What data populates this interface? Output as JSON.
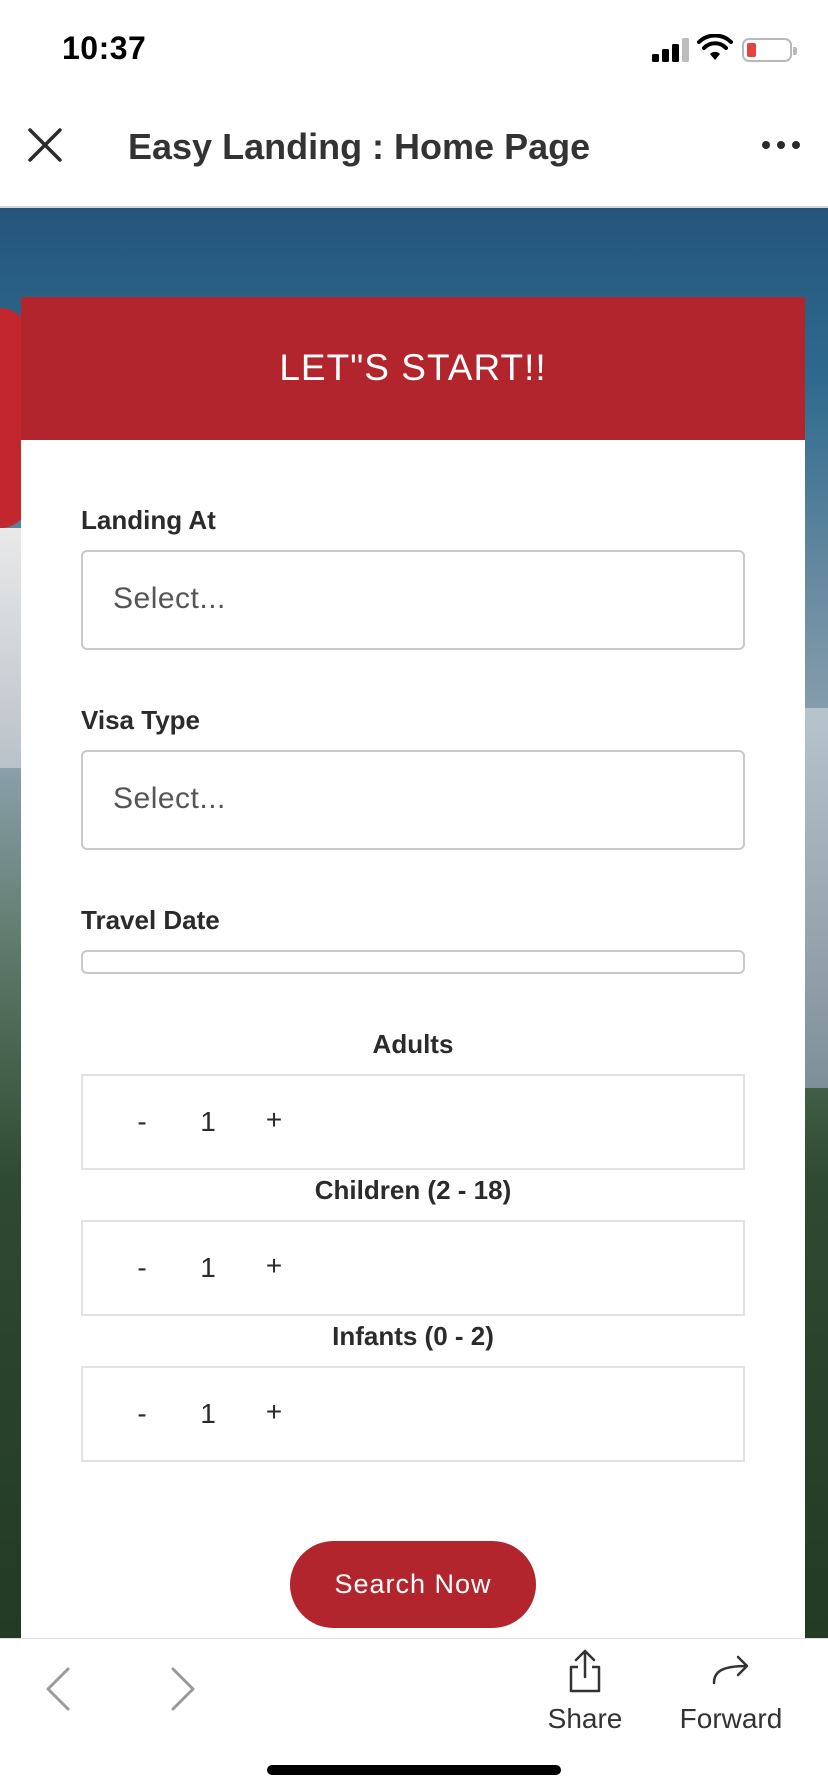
{
  "status_bar": {
    "time": "10:37"
  },
  "header": {
    "title": "Easy Landing : Home Page"
  },
  "card": {
    "title": "LET\"S START!!"
  },
  "form": {
    "landing_at": {
      "label": "Landing At",
      "placeholder": "Select..."
    },
    "visa_type": {
      "label": "Visa Type",
      "placeholder": "Select..."
    },
    "travel_date": {
      "label": "Travel Date"
    },
    "adults": {
      "label": "Adults",
      "minus": "-",
      "value": "1",
      "plus": "+"
    },
    "children": {
      "label": "Children (2 - 18)",
      "minus": "-",
      "value": "1",
      "plus": "+"
    },
    "infants": {
      "label": "Infants (0 - 2)",
      "minus": "-",
      "value": "1",
      "plus": "+"
    },
    "search_label": "Search Now"
  },
  "toolbar": {
    "share_label": "Share",
    "forward_label": "Forward"
  },
  "colors": {
    "brand_red": "#b3252c",
    "sky_blue": "#25557a"
  }
}
